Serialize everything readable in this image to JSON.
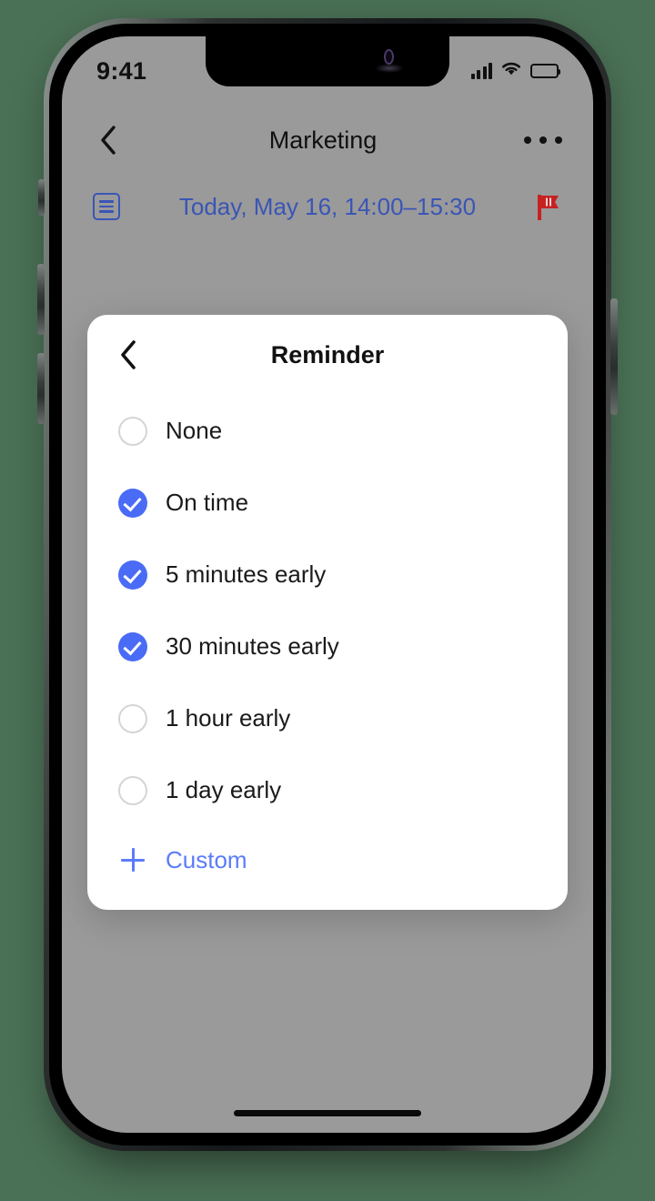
{
  "device": {
    "home_indicator": "home-indicator"
  },
  "status_bar": {
    "time": "9:41",
    "signal_icon": "cellular-signal-icon",
    "wifi_icon": "wifi-icon",
    "battery_icon": "battery-full-icon"
  },
  "app_header": {
    "back_icon": "chevron-left-icon",
    "title": "Marketing",
    "more_icon": "more-options-icon"
  },
  "date_row": {
    "list_icon": "list-icon",
    "text": "Today, May 16, 14:00–15:30",
    "flag_icon": "flag-icon",
    "text_color": "#3a55b5",
    "flag_color": "#c62222"
  },
  "modal": {
    "back_icon": "chevron-left-icon",
    "title": "Reminder",
    "options": [
      {
        "label": "None",
        "checked": false
      },
      {
        "label": "On time",
        "checked": true
      },
      {
        "label": "5 minutes early",
        "checked": true
      },
      {
        "label": "30 minutes early",
        "checked": true
      },
      {
        "label": "1 hour early",
        "checked": false
      },
      {
        "label": "1 day early",
        "checked": false
      }
    ],
    "custom": {
      "plus_icon": "plus-icon",
      "label": "Custom"
    },
    "accent_color": "#4a6bf5",
    "link_color": "#5b7cfa"
  }
}
